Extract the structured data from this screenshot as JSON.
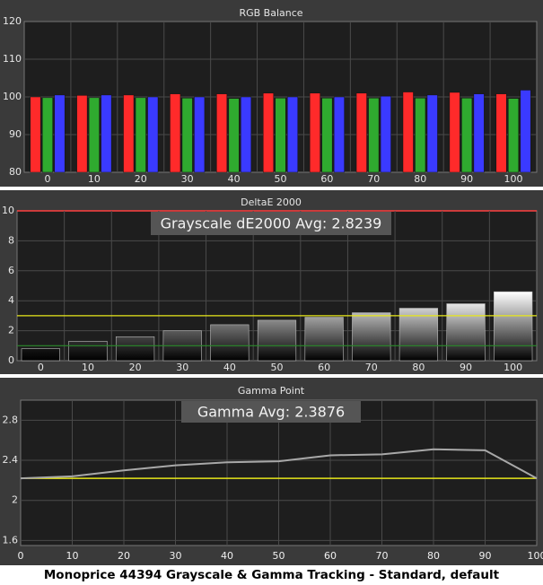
{
  "caption": "Monoprice 44394 Grayscale & Gamma Tracking - Standard, default",
  "colors": {
    "panel_bg": "#3a3a3a",
    "plot_bg": "#1e1e1e",
    "grid": "#4a4a4a",
    "text": "#e6e6e6",
    "red": "#ff2a2a",
    "green": "#2faa2f",
    "blue": "#3a3aff",
    "yellow": "#e8e81a",
    "dark_green": "#2a8a2a",
    "max_line": "#ff4040",
    "gamma_line": "#a8a8a8"
  },
  "chart_data": [
    {
      "type": "bar",
      "title": "RGB Balance",
      "categories": [
        "0",
        "10",
        "20",
        "30",
        "40",
        "50",
        "60",
        "70",
        "80",
        "90",
        "100"
      ],
      "ylim": [
        80,
        120
      ],
      "yticks": [
        "80",
        "90",
        "100",
        "110",
        "120"
      ],
      "series": [
        {
          "name": "",
          "color": "red",
          "values": [
            100.0,
            100.4,
            100.5,
            100.8,
            100.8,
            101.0,
            101.0,
            101.0,
            101.3,
            101.2,
            100.8
          ]
        },
        {
          "name": "",
          "color": "green",
          "values": [
            99.8,
            99.8,
            99.8,
            99.7,
            99.6,
            99.7,
            99.7,
            99.7,
            99.7,
            99.7,
            99.6
          ]
        },
        {
          "name": "",
          "color": "blue",
          "values": [
            100.5,
            100.5,
            100.0,
            100.0,
            100.0,
            100.0,
            100.0,
            100.2,
            100.5,
            100.8,
            101.8
          ]
        }
      ]
    },
    {
      "type": "bar",
      "title": "DeltaE 2000",
      "annotation": "Grayscale dE2000 Avg: 2.8239",
      "categories": [
        "0",
        "10",
        "20",
        "30",
        "40",
        "50",
        "60",
        "70",
        "80",
        "90",
        "100"
      ],
      "ylim": [
        0,
        10
      ],
      "yticks": [
        "0",
        "2",
        "4",
        "6",
        "8",
        "10"
      ],
      "values": [
        0.8,
        1.3,
        1.6,
        2.0,
        2.4,
        2.7,
        2.9,
        3.2,
        3.5,
        3.8,
        4.6
      ],
      "reference_lines": [
        3,
        1
      ]
    },
    {
      "type": "line",
      "title": "Gamma Point",
      "annotation": "Gamma Avg: 2.3876",
      "x": [
        0,
        10,
        20,
        30,
        40,
        50,
        60,
        70,
        80,
        90,
        100
      ],
      "xticks": [
        "0",
        "10",
        "20",
        "30",
        "40",
        "50",
        "60",
        "70",
        "80",
        "90",
        "100"
      ],
      "y": [
        2.22,
        2.24,
        2.3,
        2.35,
        2.38,
        2.39,
        2.45,
        2.46,
        2.51,
        2.5,
        2.22
      ],
      "ylim": [
        1.55,
        3.0
      ],
      "yticks": [
        "1.6",
        "2",
        "2.4",
        "2.8"
      ],
      "reference_line": 2.22
    }
  ]
}
